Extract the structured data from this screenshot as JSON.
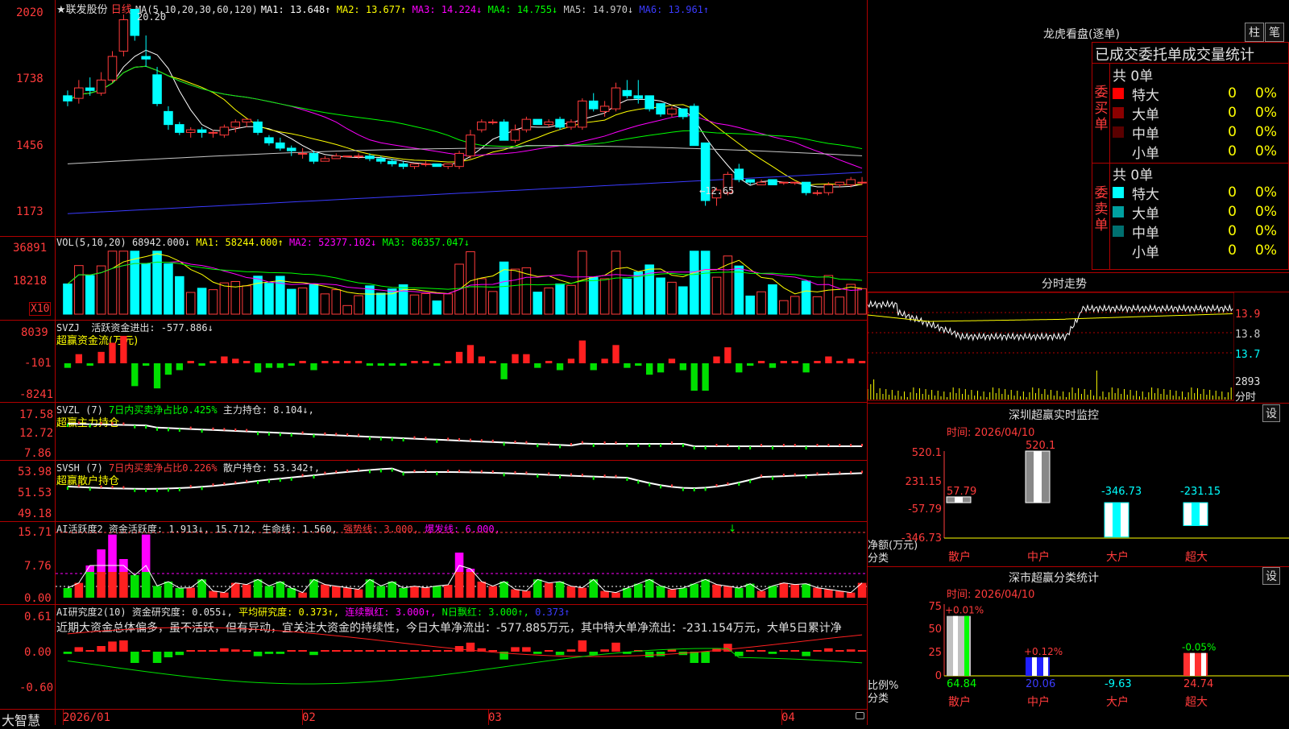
{
  "stock": {
    "name": "★联发股份",
    "period": "日线",
    "ma_params": "MA(5,10,20,30,60,120)"
  },
  "main_ma": [
    {
      "label": "MA1: 13.648↑",
      "color": "#ffffff"
    },
    {
      "label": "MA2: 13.677↑",
      "color": "#ffff00"
    },
    {
      "label": "MA3: 14.224↓",
      "color": "#ff00ff"
    },
    {
      "label": "MA4: 14.755↓",
      "color": "#00ff00"
    },
    {
      "label": "MA5: 14.970↓",
      "color": "#c8c8c8"
    },
    {
      "label": "MA6: 13.961↑",
      "color": "#3b3bff"
    }
  ],
  "price_axis": [
    "2020",
    "1738",
    "1456",
    "1173"
  ],
  "annotations": {
    "high": "20.20",
    "low": "←12.65"
  },
  "vol": {
    "title": "VOL(5,10,20)",
    "value": "68942.000↓",
    "ma": [
      {
        "label": "MA1: 58244.000↑",
        "color": "#ffff00"
      },
      {
        "label": "MA2: 52377.102↓",
        "color": "#ff00ff"
      },
      {
        "label": "MA3: 86357.047↓",
        "color": "#00ff00"
      }
    ],
    "axis": [
      "36891",
      "18218"
    ],
    "unit": "X10"
  },
  "svzj": {
    "title": "SVZJ",
    "desc": "活跃资金进出: -577.886↓",
    "sub": "超赢资金流(万元)",
    "axis": [
      "8039",
      "-101",
      "-8241"
    ]
  },
  "svzl": {
    "title": "SVZL (7)",
    "desc1": "7日内买卖净占比0.425%",
    "desc2": "主力持仓: 8.104↓,",
    "sub": "超赢主力持仓",
    "axis": [
      "17.58",
      "12.72",
      "7.86"
    ]
  },
  "svsh": {
    "title": "SVSH (7)",
    "desc1": "7日内买卖净占比0.226%",
    "desc2": "散户持仓: 53.342↑,",
    "sub": "超赢散户持仓",
    "axis": [
      "53.98",
      "51.53",
      "49.18"
    ]
  },
  "ai_active": {
    "title": "AI活跃度2",
    "desc": "资金活跃度: 1.913↓, 15.712, 生命线: 1.560,",
    "strong": "强势线: 3.000,",
    "burst": "爆发线: 6.000,",
    "axis": [
      "15.71",
      "7.76",
      "0.00"
    ]
  },
  "ai_research": {
    "title": "AI研究度2(10)",
    "desc": "资金研究度: 0.055↓,",
    "avg": "平均研究度: 0.373↑,",
    "red": "连续飘红: 3.000↑,",
    "nred": "N日飘红: 3.000↑,",
    "tail": "0.373↑",
    "axis": [
      "0.61",
      "0.00",
      "-0.60"
    ],
    "comment": "近期大资金总体偏多，虽不活跃，但有异动，宜关注大资金的持续性，今日大单净流出：-577.885万元，其中特大单净流出：-231.154万元，大单5日累计净"
  },
  "date_axis": [
    "2026/01",
    "02",
    "03",
    "04"
  ],
  "brand": "大智慧",
  "right": {
    "title": "龙虎看盘(逐单)",
    "btn1": "柱",
    "btn2": "笔",
    "order_title": "已成交委托单成交量统计",
    "buy": {
      "side": "委买单",
      "total": "共 0单",
      "rows": [
        {
          "name": "特大",
          "count": "0",
          "pct": "0%",
          "color": "#ff0000"
        },
        {
          "name": "大单",
          "count": "0",
          "pct": "0%",
          "color": "#8b0000"
        },
        {
          "name": "中单",
          "count": "0",
          "pct": "0%",
          "color": "#5a0000"
        },
        {
          "name": "小单",
          "count": "0",
          "pct": "0%",
          "color": "#000000"
        }
      ]
    },
    "sell": {
      "side": "委卖单",
      "total": "共 0单",
      "rows": [
        {
          "name": "特大",
          "count": "0",
          "pct": "0%",
          "color": "#00ffff"
        },
        {
          "name": "大单",
          "count": "0",
          "pct": "0%",
          "color": "#00a0a0"
        },
        {
          "name": "中单",
          "count": "0",
          "pct": "0%",
          "color": "#007070"
        },
        {
          "name": "小单",
          "count": "0",
          "pct": "0%",
          "color": "#000000"
        }
      ]
    },
    "intraday": {
      "title": "分时走势",
      "axis": [
        "13.9",
        "13.8",
        "13.7",
        "2893"
      ],
      "vol_label": "分时"
    },
    "monitor": {
      "title": "深圳超赢实时监控",
      "set": "设",
      "time": "时间: 2026/04/10",
      "axis": [
        "520.1",
        "231.15",
        "-57.79",
        "-346.73"
      ],
      "ylabel": "净额(万元)",
      "xlabel": "分类",
      "bars": [
        {
          "cat": "散户",
          "label": "57.79",
          "value": 57.79
        },
        {
          "cat": "中户",
          "label": "520.1",
          "value": 520.1
        },
        {
          "cat": "大户",
          "label": "-346.73",
          "value": -346.73
        },
        {
          "cat": "超大",
          "label": "-231.15",
          "value": -231.15
        }
      ]
    },
    "classify": {
      "title": "深市超赢分类统计",
      "set": "设",
      "time": "时间: 2026/04/10",
      "axis": [
        "75",
        "50",
        "25",
        "0"
      ],
      "ylabel": "比例%",
      "xlabel": "分类",
      "bars": [
        {
          "cat": "散户",
          "top": "+0.01%",
          "bottom": "64.84",
          "value": 64.84
        },
        {
          "cat": "中户",
          "top": "+0.12%",
          "bottom": "20.06",
          "value": 20.06
        },
        {
          "cat": "大户",
          "top": "",
          "bottom": "-9.63",
          "value": 0
        },
        {
          "cat": "超大",
          "top": "-0.05%",
          "bottom": "24.74",
          "value": 24.74
        }
      ]
    }
  },
  "chart_data": {
    "type": "candlestick",
    "candles": [
      [
        16.9,
        17.1,
        16.5,
        16.7
      ],
      [
        16.8,
        17.5,
        16.6,
        17.2
      ],
      [
        17.2,
        17.6,
        16.9,
        17.1
      ],
      [
        17.0,
        17.8,
        16.9,
        17.5
      ],
      [
        17.5,
        18.6,
        17.4,
        18.4
      ],
      [
        18.6,
        20.0,
        18.4,
        19.8
      ],
      [
        20.2,
        20.2,
        19.0,
        19.2
      ],
      [
        18.4,
        19.2,
        18.0,
        18.3
      ],
      [
        17.7,
        18.0,
        16.5,
        16.6
      ],
      [
        16.3,
        16.5,
        15.6,
        15.8
      ],
      [
        15.8,
        15.9,
        15.4,
        15.5
      ],
      [
        15.5,
        15.7,
        15.3,
        15.6
      ],
      [
        15.6,
        15.7,
        15.3,
        15.5
      ],
      [
        15.5,
        15.6,
        15.3,
        15.5
      ],
      [
        15.4,
        15.8,
        15.3,
        15.7
      ],
      [
        15.7,
        16.0,
        15.5,
        15.9
      ],
      [
        15.9,
        16.0,
        15.7,
        16.0
      ],
      [
        15.9,
        16.0,
        15.4,
        15.5
      ],
      [
        15.3,
        15.4,
        15.0,
        15.1
      ],
      [
        15.1,
        15.3,
        14.8,
        14.9
      ],
      [
        14.9,
        15.0,
        14.6,
        14.8
      ],
      [
        14.7,
        14.9,
        14.5,
        14.7
      ],
      [
        14.7,
        14.8,
        14.3,
        14.4
      ],
      [
        14.4,
        14.6,
        14.4,
        14.5
      ],
      [
        14.5,
        14.7,
        14.5,
        14.6
      ],
      [
        14.6,
        14.6,
        14.6,
        14.6
      ],
      [
        14.6,
        14.7,
        14.5,
        14.6
      ],
      [
        14.6,
        14.7,
        14.4,
        14.5
      ],
      [
        14.5,
        14.6,
        14.3,
        14.4
      ],
      [
        14.4,
        14.5,
        14.2,
        14.3
      ],
      [
        14.3,
        14.4,
        14.1,
        14.2
      ],
      [
        14.2,
        14.3,
        14.1,
        14.3
      ],
      [
        14.3,
        14.4,
        14.2,
        14.3
      ],
      [
        14.3,
        14.3,
        14.2,
        14.2
      ],
      [
        14.2,
        14.3,
        14.1,
        14.3
      ],
      [
        14.2,
        14.8,
        14.1,
        14.7
      ],
      [
        14.6,
        15.6,
        14.5,
        15.4
      ],
      [
        15.6,
        16.0,
        15.5,
        15.9
      ],
      [
        15.9,
        16.0,
        15.8,
        15.9
      ],
      [
        15.9,
        16.0,
        15.2,
        15.2
      ],
      [
        15.2,
        15.8,
        15.1,
        15.6
      ],
      [
        15.6,
        16.1,
        15.5,
        16.0
      ],
      [
        16.0,
        16.0,
        15.8,
        15.8
      ],
      [
        15.8,
        16.0,
        15.7,
        15.9
      ],
      [
        16.0,
        16.1,
        15.6,
        15.7
      ],
      [
        15.7,
        16.0,
        15.6,
        15.9
      ],
      [
        15.7,
        16.8,
        15.6,
        16.7
      ],
      [
        16.7,
        17.0,
        16.3,
        16.4
      ],
      [
        16.3,
        16.7,
        16.1,
        16.5
      ],
      [
        16.4,
        17.4,
        16.3,
        17.2
      ],
      [
        17.1,
        17.5,
        16.8,
        16.9
      ],
      [
        16.9,
        17.5,
        16.6,
        16.8
      ],
      [
        16.9,
        16.9,
        16.3,
        16.4
      ],
      [
        16.6,
        16.6,
        16.1,
        16.2
      ],
      [
        16.2,
        16.5,
        16.1,
        16.4
      ],
      [
        16.4,
        16.4,
        16.0,
        16.1
      ],
      [
        16.5,
        16.6,
        15.0,
        15.0
      ],
      [
        15.1,
        15.1,
        12.7,
        12.9
      ],
      [
        13.0,
        13.4,
        12.7,
        13.3
      ],
      [
        13.2,
        14.0,
        13.1,
        13.9
      ],
      [
        14.1,
        14.3,
        13.6,
        13.7
      ],
      [
        13.7,
        13.7,
        13.5,
        13.6
      ],
      [
        13.5,
        13.7,
        13.5,
        13.6
      ],
      [
        13.7,
        13.7,
        13.5,
        13.5
      ],
      [
        13.6,
        13.6,
        13.5,
        13.6
      ],
      [
        13.6,
        13.6,
        13.5,
        13.6
      ],
      [
        13.6,
        13.6,
        13.1,
        13.2
      ],
      [
        13.2,
        13.3,
        13.1,
        13.2
      ],
      [
        13.2,
        13.6,
        13.1,
        13.5
      ],
      [
        13.5,
        13.6,
        13.4,
        13.6
      ],
      [
        13.5,
        13.8,
        13.4,
        13.7
      ],
      [
        13.6,
        13.8,
        13.5,
        13.6
      ]
    ]
  }
}
